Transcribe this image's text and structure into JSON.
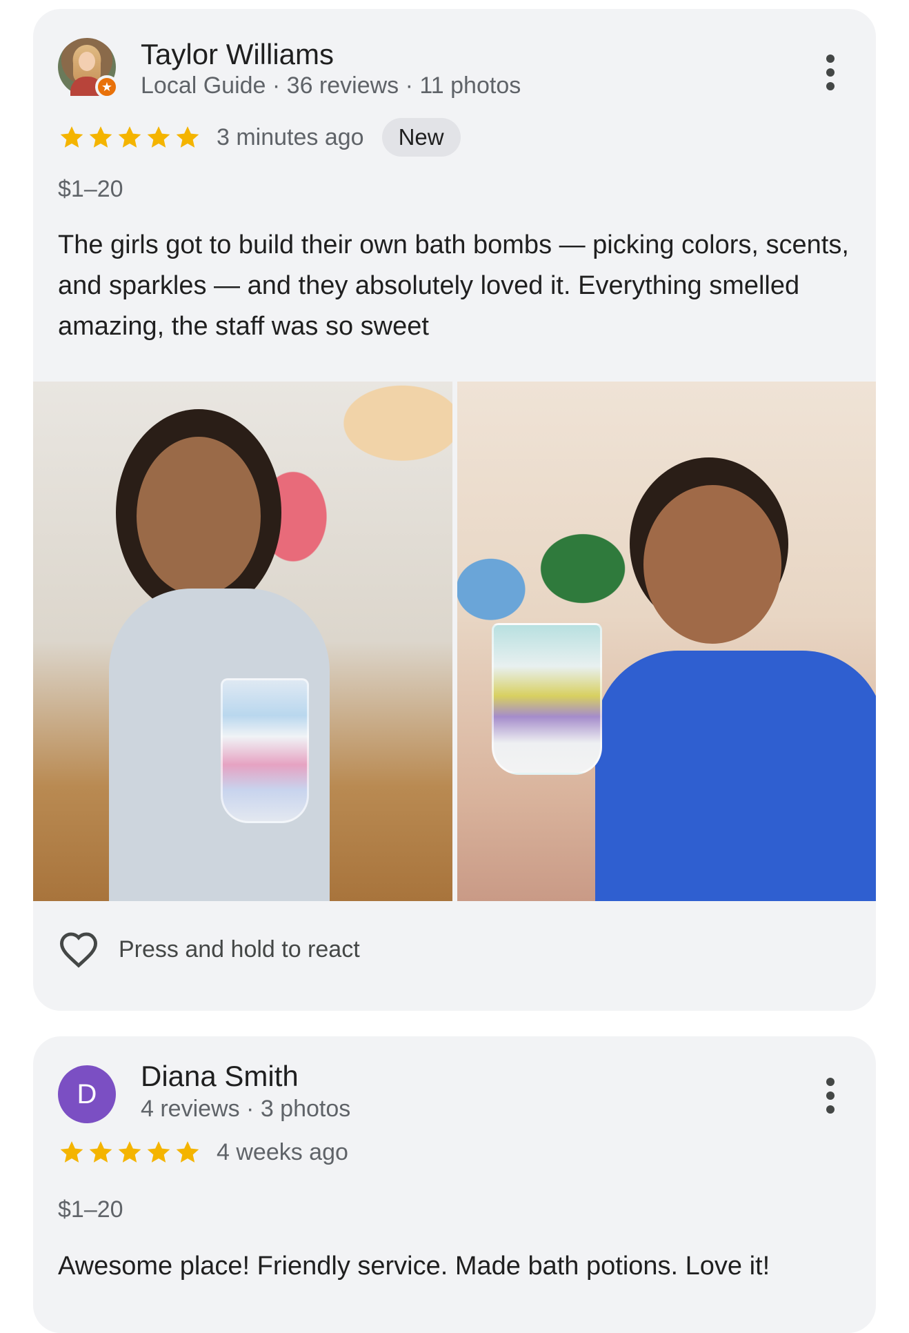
{
  "reviews": [
    {
      "reviewer_name": "Taylor Williams",
      "reviewer_meta": "Local Guide · 36 reviews · 11 photos",
      "rating": 5,
      "time": "3 minutes ago",
      "badge": "New",
      "price": "$1–20",
      "text": "The girls got to build their own bath bombs — picking colors, scents, and sparkles — and they absolutely loved it. Everything smelled amazing, the staff was so sweet",
      "react_label": "Press and hold to react"
    },
    {
      "reviewer_name": "Diana Smith",
      "reviewer_initial": "D",
      "reviewer_meta": "4 reviews · 3 photos",
      "rating": 5,
      "time": "4 weeks ago",
      "price": "$1–20",
      "text": "Awesome place! Friendly service. Made bath potions. Love it!"
    }
  ],
  "colors": {
    "star": "#f4b400",
    "card_bg": "#f2f3f5",
    "avatar_d": "#7b4fc3",
    "guide_badge": "#e8710a"
  },
  "icons": [
    "more-vert-icon",
    "star-icon",
    "heart-outline-icon",
    "local-guide-badge-icon"
  ]
}
